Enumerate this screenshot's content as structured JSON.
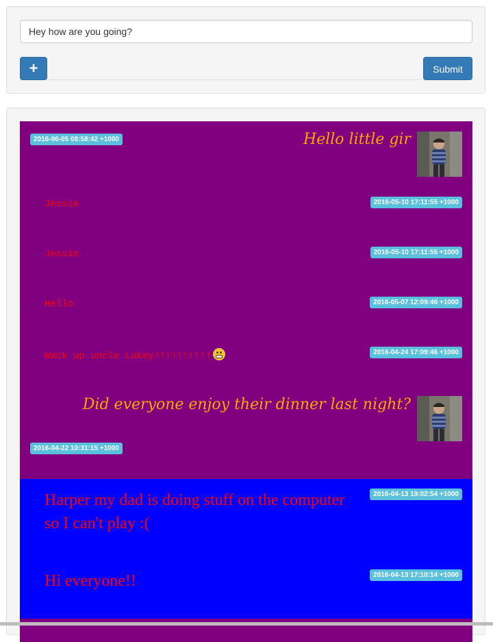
{
  "composer": {
    "message_value": "Hey how are you going?",
    "add_label": "+",
    "submit_label": "Submit"
  },
  "posts": [
    {
      "timestamp": "2016-06-05 08:58:42 +1000",
      "text": "Hello little gir",
      "style": "fancy",
      "has_avatar": true
    },
    {
      "timestamp": "2016-05-10 17:11:55 +1000",
      "text": "Jessie",
      "style": "mono"
    },
    {
      "timestamp": "2016-05-10 17:11:55 +1000",
      "text": "Jessie",
      "style": "mono"
    },
    {
      "timestamp": "2016-05-07 12:09:46 +1000",
      "text": "Hello",
      "style": "mono"
    },
    {
      "timestamp": "2016-04-24 17:09:46 +1000",
      "text": "Wack up uncle Lukey!!!!!!!!!!",
      "style": "mono",
      "emoji": "grimacing-face-icon"
    },
    {
      "timestamp": "2016-04-22 10:31:15 +1000",
      "text": "Did everyone enjoy their dinner last night?",
      "style": "fancy",
      "has_avatar": true
    },
    {
      "timestamp": "2016-04-13 19:02:54 +1000",
      "text": "Harper my dad is doing stuff on the computer so I can't play :(",
      "style": "serif"
    },
    {
      "timestamp": "2016-04-13 17:10:14 +1000",
      "text": "Hi everyone!!",
      "style": "serif"
    }
  ],
  "colors": {
    "purple_background": "#800080",
    "blue_background": "#0000ff",
    "timestamp_badge": "#5bc0de",
    "fancy_text": "#ffa500",
    "red_text": "#ff0000",
    "button_primary": "#337ab7"
  }
}
